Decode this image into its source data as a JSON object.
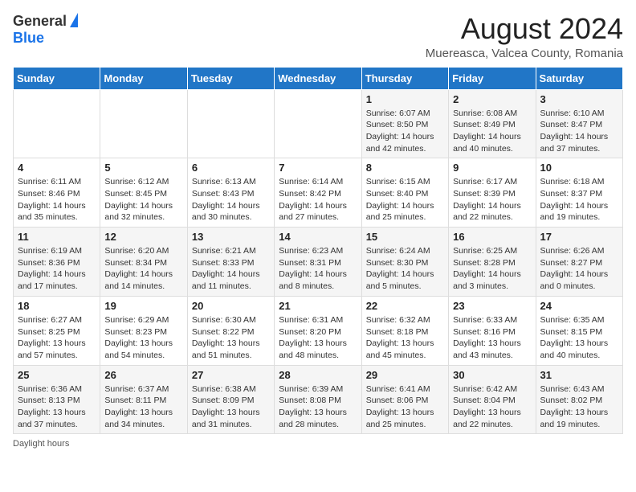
{
  "header": {
    "logo_general": "General",
    "logo_blue": "Blue",
    "title": "August 2024",
    "subtitle": "Muereasca, Valcea County, Romania"
  },
  "calendar": {
    "days_of_week": [
      "Sunday",
      "Monday",
      "Tuesday",
      "Wednesday",
      "Thursday",
      "Friday",
      "Saturday"
    ],
    "weeks": [
      [
        {
          "day": "",
          "info": ""
        },
        {
          "day": "",
          "info": ""
        },
        {
          "day": "",
          "info": ""
        },
        {
          "day": "",
          "info": ""
        },
        {
          "day": "1",
          "info": "Sunrise: 6:07 AM\nSunset: 8:50 PM\nDaylight: 14 hours and 42 minutes."
        },
        {
          "day": "2",
          "info": "Sunrise: 6:08 AM\nSunset: 8:49 PM\nDaylight: 14 hours and 40 minutes."
        },
        {
          "day": "3",
          "info": "Sunrise: 6:10 AM\nSunset: 8:47 PM\nDaylight: 14 hours and 37 minutes."
        }
      ],
      [
        {
          "day": "4",
          "info": "Sunrise: 6:11 AM\nSunset: 8:46 PM\nDaylight: 14 hours and 35 minutes."
        },
        {
          "day": "5",
          "info": "Sunrise: 6:12 AM\nSunset: 8:45 PM\nDaylight: 14 hours and 32 minutes."
        },
        {
          "day": "6",
          "info": "Sunrise: 6:13 AM\nSunset: 8:43 PM\nDaylight: 14 hours and 30 minutes."
        },
        {
          "day": "7",
          "info": "Sunrise: 6:14 AM\nSunset: 8:42 PM\nDaylight: 14 hours and 27 minutes."
        },
        {
          "day": "8",
          "info": "Sunrise: 6:15 AM\nSunset: 8:40 PM\nDaylight: 14 hours and 25 minutes."
        },
        {
          "day": "9",
          "info": "Sunrise: 6:17 AM\nSunset: 8:39 PM\nDaylight: 14 hours and 22 minutes."
        },
        {
          "day": "10",
          "info": "Sunrise: 6:18 AM\nSunset: 8:37 PM\nDaylight: 14 hours and 19 minutes."
        }
      ],
      [
        {
          "day": "11",
          "info": "Sunrise: 6:19 AM\nSunset: 8:36 PM\nDaylight: 14 hours and 17 minutes."
        },
        {
          "day": "12",
          "info": "Sunrise: 6:20 AM\nSunset: 8:34 PM\nDaylight: 14 hours and 14 minutes."
        },
        {
          "day": "13",
          "info": "Sunrise: 6:21 AM\nSunset: 8:33 PM\nDaylight: 14 hours and 11 minutes."
        },
        {
          "day": "14",
          "info": "Sunrise: 6:23 AM\nSunset: 8:31 PM\nDaylight: 14 hours and 8 minutes."
        },
        {
          "day": "15",
          "info": "Sunrise: 6:24 AM\nSunset: 8:30 PM\nDaylight: 14 hours and 5 minutes."
        },
        {
          "day": "16",
          "info": "Sunrise: 6:25 AM\nSunset: 8:28 PM\nDaylight: 14 hours and 3 minutes."
        },
        {
          "day": "17",
          "info": "Sunrise: 6:26 AM\nSunset: 8:27 PM\nDaylight: 14 hours and 0 minutes."
        }
      ],
      [
        {
          "day": "18",
          "info": "Sunrise: 6:27 AM\nSunset: 8:25 PM\nDaylight: 13 hours and 57 minutes."
        },
        {
          "day": "19",
          "info": "Sunrise: 6:29 AM\nSunset: 8:23 PM\nDaylight: 13 hours and 54 minutes."
        },
        {
          "day": "20",
          "info": "Sunrise: 6:30 AM\nSunset: 8:22 PM\nDaylight: 13 hours and 51 minutes."
        },
        {
          "day": "21",
          "info": "Sunrise: 6:31 AM\nSunset: 8:20 PM\nDaylight: 13 hours and 48 minutes."
        },
        {
          "day": "22",
          "info": "Sunrise: 6:32 AM\nSunset: 8:18 PM\nDaylight: 13 hours and 45 minutes."
        },
        {
          "day": "23",
          "info": "Sunrise: 6:33 AM\nSunset: 8:16 PM\nDaylight: 13 hours and 43 minutes."
        },
        {
          "day": "24",
          "info": "Sunrise: 6:35 AM\nSunset: 8:15 PM\nDaylight: 13 hours and 40 minutes."
        }
      ],
      [
        {
          "day": "25",
          "info": "Sunrise: 6:36 AM\nSunset: 8:13 PM\nDaylight: 13 hours and 37 minutes."
        },
        {
          "day": "26",
          "info": "Sunrise: 6:37 AM\nSunset: 8:11 PM\nDaylight: 13 hours and 34 minutes."
        },
        {
          "day": "27",
          "info": "Sunrise: 6:38 AM\nSunset: 8:09 PM\nDaylight: 13 hours and 31 minutes."
        },
        {
          "day": "28",
          "info": "Sunrise: 6:39 AM\nSunset: 8:08 PM\nDaylight: 13 hours and 28 minutes."
        },
        {
          "day": "29",
          "info": "Sunrise: 6:41 AM\nSunset: 8:06 PM\nDaylight: 13 hours and 25 minutes."
        },
        {
          "day": "30",
          "info": "Sunrise: 6:42 AM\nSunset: 8:04 PM\nDaylight: 13 hours and 22 minutes."
        },
        {
          "day": "31",
          "info": "Sunrise: 6:43 AM\nSunset: 8:02 PM\nDaylight: 13 hours and 19 minutes."
        }
      ]
    ]
  },
  "footer": {
    "daylight_label": "Daylight hours"
  }
}
